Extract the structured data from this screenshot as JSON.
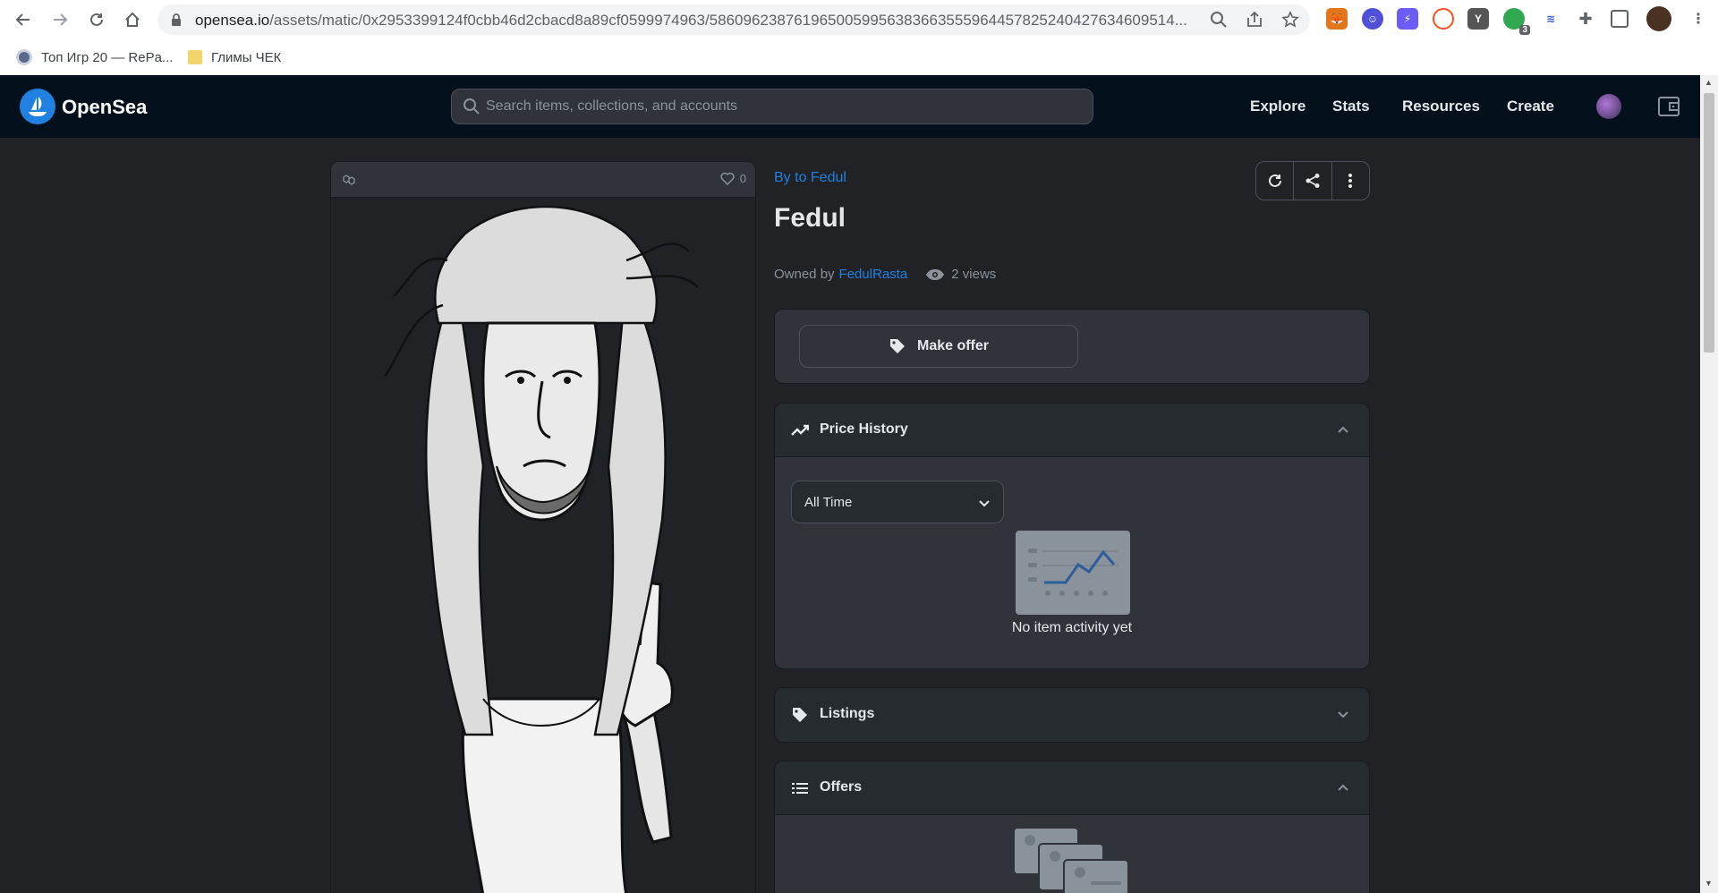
{
  "browser": {
    "url_host": "opensea.io",
    "url_path": "/assets/matic/0x2953399124f0cbb46d2cbacd8a89cf0599974963/5860962387619650059956383663555964457825240427634609514...",
    "bookmarks": [
      {
        "label": "Топ Игр 20 — RePa..."
      },
      {
        "label": "Глимы ЧЕК"
      }
    ],
    "extension_badge": "3"
  },
  "header": {
    "brand": "OpenSea",
    "search_placeholder": "Search items, collections, and accounts",
    "nav": [
      "Explore",
      "Stats",
      "Resources",
      "Create"
    ]
  },
  "asset": {
    "favorites": "0",
    "collection": "By to Fedul",
    "title": "Fedul",
    "owned_by_label": "Owned by",
    "owner": "FedulRasta",
    "views": "2 views"
  },
  "offer_button": "Make offer",
  "price_history": {
    "title": "Price History",
    "select_value": "All Time",
    "empty_text": "No item activity yet"
  },
  "listings": {
    "title": "Listings"
  },
  "offers": {
    "title": "Offers"
  },
  "colors": {
    "accent": "#2081e2",
    "header_bg": "#04111d",
    "page_bg": "#202225",
    "panel_bg": "#262b2f"
  }
}
